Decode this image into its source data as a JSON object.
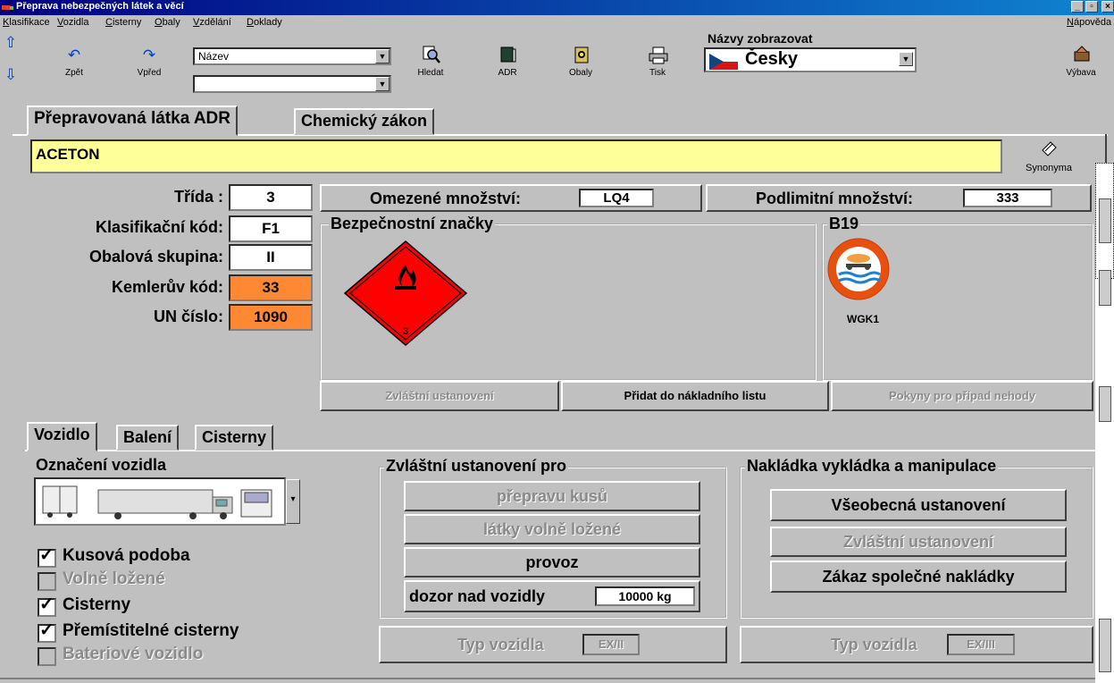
{
  "window": {
    "title": "Přeprava nebezpečných látek a věcí"
  },
  "menu": [
    "Klasifikace",
    "Vozidla",
    "Cisterny",
    "Obaly",
    "Vzdělání",
    "Doklady"
  ],
  "menu_help": "Nápověda",
  "toolbar": {
    "back": "Zpět",
    "forward": "Vpřed",
    "search_field_value": "Název",
    "search_value": "",
    "search": "Hledat",
    "adr": "ADR",
    "obaly": "Obaly",
    "print": "Tisk",
    "names_label": "Názvy zobrazovat",
    "language": "Česky",
    "vybava": "Výbava"
  },
  "main_tabs": [
    "Přepravovaná látka ADR",
    "Chemický zákon"
  ],
  "substance": {
    "name": "ACETON",
    "synonyms_label": "Synonyma"
  },
  "props": {
    "trida_label": "Třída :",
    "trida": "3",
    "klas_label": "Klasifikační kód:",
    "klas": "F1",
    "obal_label": "Obalová skupina:",
    "obal": "II",
    "kemler_label": "Kemlerův kód:",
    "kemler": "33",
    "un_label": "UN číslo:",
    "un": "1090"
  },
  "limited": {
    "label": "Omezené množství:",
    "value": "LQ4"
  },
  "sublimit": {
    "label": "Podlimitní množství:",
    "value": "333"
  },
  "signs": {
    "title": "Bezpečnostní značky",
    "diamond_number": "3"
  },
  "b19": {
    "title": "B19",
    "caption": "WGK1"
  },
  "actions": {
    "special": "Zvláštní ustanovení",
    "add": "Přidat do nákladního listu",
    "accident": "Pokyny pro případ nehody"
  },
  "sub_tabs": [
    "Vozidlo",
    "Balení",
    "Cisterny"
  ],
  "vehicle": {
    "marking_label": "Označení vozidla",
    "checks": [
      {
        "label": "Kusová podoba",
        "checked": true,
        "enabled": true
      },
      {
        "label": "Volně ložené",
        "checked": false,
        "enabled": false
      },
      {
        "label": "Cisterny",
        "checked": true,
        "enabled": true
      },
      {
        "label": "Přemístitelné cisterny",
        "checked": true,
        "enabled": true
      },
      {
        "label": "Bateriové vozidlo",
        "checked": false,
        "enabled": false
      }
    ]
  },
  "special_group": {
    "title": "Zvláštní ustanovení pro",
    "b1": "přepravu kusů",
    "b2": "látky volně ložené",
    "b3": "provoz",
    "b4": "dozor nad vozidly",
    "b4_value": "10000 kg"
  },
  "loading_group": {
    "title": "Nakládka vykládka a manipulace",
    "b1": "Všeobecná ustanovení",
    "b2": "Zvláštní ustanovení",
    "b3": "Zákaz společné nakládky"
  },
  "vehicle_type_1": {
    "label": "Typ vozidla",
    "value": "EX/II"
  },
  "vehicle_type_2": {
    "label": "Typ vozidla",
    "value": "EX/III"
  },
  "colors": {
    "yellow": "#ffff99",
    "orange": "#ff8833",
    "sign_red": "#ff0000"
  }
}
